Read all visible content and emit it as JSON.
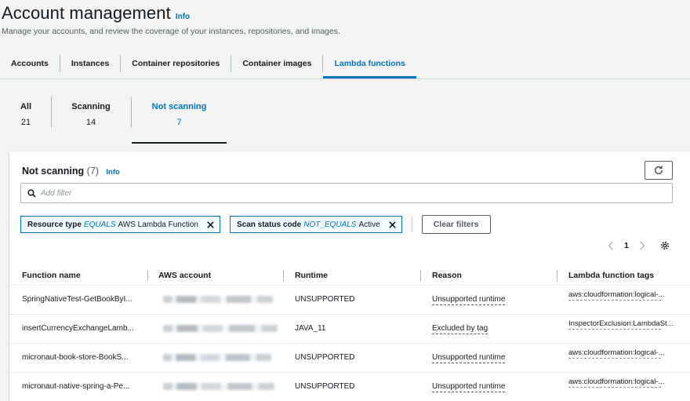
{
  "header": {
    "title": "Account management",
    "info": "Info",
    "subtitle": "Manage your accounts, and review the coverage of your instances, repositories, and images."
  },
  "tabs": [
    {
      "label": "Accounts",
      "active": false
    },
    {
      "label": "Instances",
      "active": false
    },
    {
      "label": "Container repositories",
      "active": false
    },
    {
      "label": "Container images",
      "active": false
    },
    {
      "label": "Lambda functions",
      "active": true
    }
  ],
  "counters": [
    {
      "label": "All",
      "value": "21",
      "active": false
    },
    {
      "label": "Scanning",
      "value": "14",
      "active": false
    },
    {
      "label": "Not scanning",
      "value": "7",
      "active": true
    }
  ],
  "panel": {
    "title": "Not scanning",
    "count": "(7)",
    "info": "Info",
    "filter_placeholder": "Add filter",
    "tokens": [
      {
        "key": "Resource type",
        "op": "EQUALS",
        "value": "AWS Lambda Function"
      },
      {
        "key": "Scan status code",
        "op": "NOT_EQUALS",
        "value": "Active"
      }
    ],
    "clear_filters": "Clear filters",
    "page": "1"
  },
  "table": {
    "columns": [
      "Function name",
      "AWS account",
      "Runtime",
      "Reason",
      "Lambda function tags"
    ],
    "rows": [
      {
        "name": "SpringNativeTest-GetBookByI...",
        "runtime": "UNSUPPORTED",
        "reason": "Unsupported runtime",
        "tags": "aws:cloudformation:logical-..."
      },
      {
        "name": "insertCurrencyExchangeLamb...",
        "runtime": "JAVA_11",
        "reason": "Excluded by tag",
        "tags": "InspectorExclusion:LambdaSt..."
      },
      {
        "name": "micronaut-book-store-BookS...",
        "runtime": "UNSUPPORTED",
        "reason": "Unsupported runtime",
        "tags": "aws:cloudformation:logical-..."
      },
      {
        "name": "micronaut-native-spring-a-Pe...",
        "runtime": "UNSUPPORTED",
        "reason": "Unsupported runtime",
        "tags": "aws:cloudformation:logical-..."
      }
    ]
  },
  "colors": {
    "link": "#0073bb",
    "text": "#16191f",
    "secondary": "#545b64",
    "background": "#f2f3f3"
  },
  "icons": [
    "refresh-icon",
    "search-icon",
    "close-icon",
    "chevron-left-icon",
    "chevron-right-icon",
    "gear-icon"
  ]
}
